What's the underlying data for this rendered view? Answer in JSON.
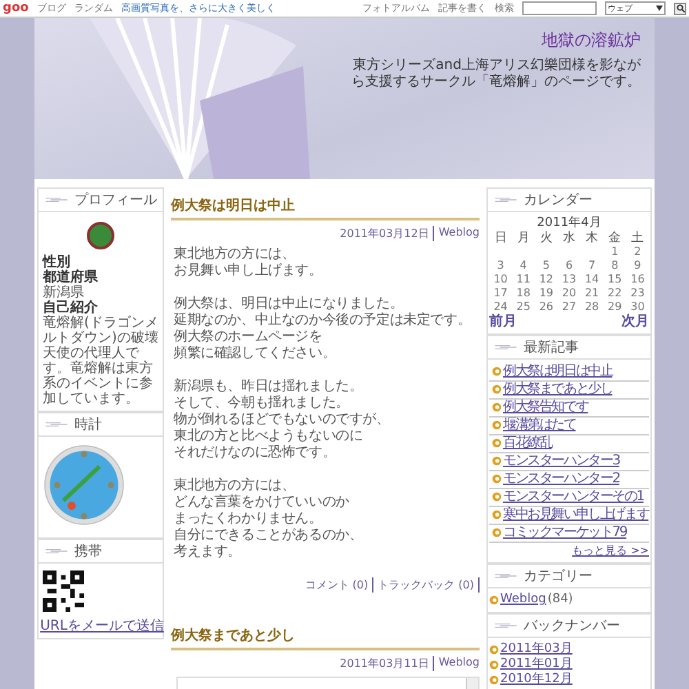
{
  "topbar": {
    "logo": "goo",
    "links": [
      "ブログ",
      "ランダム"
    ],
    "promo": "高画質写真を、さらに大きく美しく",
    "actions": [
      "フォトアルバム",
      "記事を書く"
    ],
    "search_label": "検索",
    "search_scope": "ウェブ"
  },
  "header": {
    "title": "地獄の溶鉱炉",
    "description": "東方シリーズand上海アリス幻樂団様を影ながら支援するサークル「竜熔解」のページです。"
  },
  "profile": {
    "heading": "プロフィール",
    "fields": [
      {
        "label": "性別"
      },
      {
        "label": "都道府県",
        "value": "新潟県"
      },
      {
        "label": "自己紹介",
        "value": "竜熔解(ドラゴンメルトダウン)の破壊天使の代理人です。竜熔解は東方系のイベントに参加しています。"
      }
    ]
  },
  "clock": {
    "heading": "時計"
  },
  "mobile": {
    "heading": "携帯",
    "link": "URLをメールで送信"
  },
  "posts": [
    {
      "title": "例大祭は明日は中止",
      "date": "2011年03月12日",
      "category": "Weblog",
      "paragraphs": [
        [
          "東北地方の方には、",
          "お見舞い申し上げます。"
        ],
        [
          "例大祭は、明日は中止になりました。",
          "延期なのか、中止なのか今後の予定は未定です。",
          "例大祭のホームページを",
          "頻繁に確認してください。"
        ],
        [
          "新潟県も、昨日は揺れました。",
          "そして、今朝も揺れました。",
          "物が倒れるほどでもないのですが、",
          "東北の方と比べようもないのに",
          "それだけなのに恐怖です。"
        ],
        [
          "東北地方の方には、",
          "どんな言葉をかけていいのか",
          "まったくわかりません。",
          "自分にできることがあるのか、",
          "考えます。"
        ]
      ],
      "comments": "コメント (0)",
      "trackbacks": "トラックバック (0)"
    },
    {
      "title": "例大祭まであと少し",
      "date": "2011年03月11日",
      "category": "Weblog"
    }
  ],
  "calendar": {
    "heading": "カレンダー",
    "month": "2011年4月",
    "weekdays": [
      "日",
      "月",
      "火",
      "水",
      "木",
      "金",
      "土"
    ],
    "weeks": [
      [
        "1",
        "2"
      ],
      [
        "3",
        "4",
        "5",
        "6",
        "7",
        "8",
        "9"
      ],
      [
        "10",
        "11",
        "12",
        "13",
        "14",
        "15",
        "16"
      ],
      [
        "17",
        "18",
        "19",
        "20",
        "21",
        "22",
        "23"
      ],
      [
        "24",
        "25",
        "26",
        "27",
        "28",
        "29",
        "30"
      ]
    ],
    "prev": "前月",
    "next": "次月"
  },
  "recent": {
    "heading": "最新記事",
    "items": [
      "例大祭は明日は中止",
      "例大祭まであと少し",
      "例大祭告知です",
      "堰溝第はたて",
      "百花繚乱",
      "モンスターハンター3",
      "モンスターハンター2",
      "モンスターハンターその1",
      "寒中お見舞い申し上げます",
      "コミックマーケット79"
    ],
    "more": "もっと見る >>"
  },
  "categories": {
    "heading": "カテゴリー",
    "items": [
      {
        "name": "Weblog",
        "count": "(84)"
      }
    ]
  },
  "backnumbers": {
    "heading": "バックナンバー",
    "items": [
      "2011年03月",
      "2011年01月",
      "2010年12月"
    ]
  }
}
